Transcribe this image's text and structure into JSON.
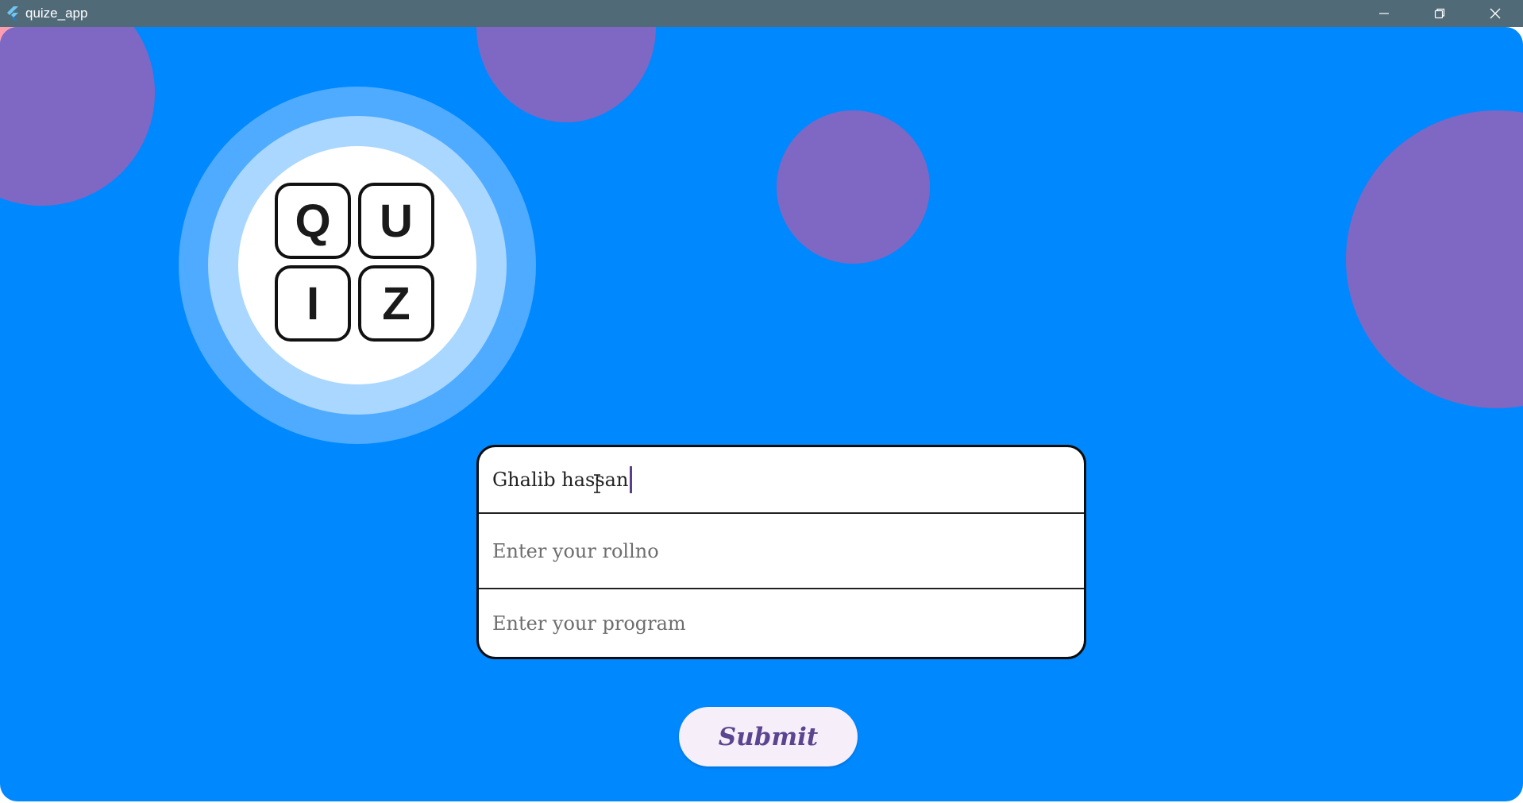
{
  "window": {
    "title": "quize_app",
    "app_icon": "flutter-icon",
    "controls": {
      "minimize_icon": "minimize-icon",
      "restore_icon": "restore-icon",
      "close_icon": "close-icon"
    }
  },
  "logo": {
    "letters": [
      "Q",
      "U",
      "I",
      "Z"
    ]
  },
  "form": {
    "name_value": "Ghalib hassan",
    "rollno_placeholder": "Enter your rollno",
    "program_placeholder": "Enter your program"
  },
  "submit_label": "Submit",
  "colors": {
    "background": "#0088ff",
    "bubbles": "#7f67c4",
    "titlebar": "#516a78",
    "submit_text": "#5b4590",
    "submit_bg": "#f6eef8"
  }
}
